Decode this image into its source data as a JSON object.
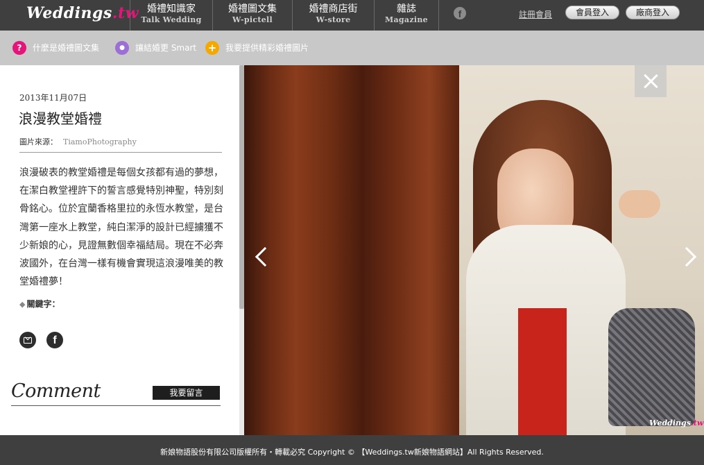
{
  "header": {
    "logo": {
      "brand": "Weddings",
      "tld": ".tw"
    },
    "nav": [
      {
        "zh": "婚禮知識家",
        "en": "Talk Wedding"
      },
      {
        "zh": "婚禮圖文集",
        "en": "W-pictell"
      },
      {
        "zh": "婚禮商店街",
        "en": "W-store"
      },
      {
        "zh": "雜誌",
        "en": "Magazine"
      }
    ],
    "facebook_glyph": "f",
    "register_label": "註冊會員",
    "member_login_label": "會員登入",
    "vendor_login_label": "廠商登入"
  },
  "subnav": [
    {
      "label": "什麼是婚禮圖文集",
      "icon": "question-icon",
      "glyph": "?",
      "color": "#e4147a"
    },
    {
      "label": "讓結婚更 Smart",
      "icon": "bulb-icon",
      "glyph": "●",
      "color": "#9b6fd6"
    },
    {
      "label": "我要提供精彩婚禮圖片",
      "icon": "plus-icon",
      "glyph": "+",
      "color": "#f5a800"
    }
  ],
  "article": {
    "date": "2013年11月07日",
    "title": "浪漫教堂婚禮",
    "source_label": "圖片來源：",
    "source_value": "TiamoPhotography",
    "description": "浪漫破表的教堂婚禮是每個女孩都有過的夢想，在潔白教堂裡許下的誓言感覺特別神聖，特別刻骨銘心。位於宜蘭香格里拉的永恆水教堂，是台灣第一座水上教堂，純白潔淨的設計已經擄獲不少新娘的心，見證無數個幸福結局。現在不必奔波國外，在台灣一樣有機會實現這浪漫唯美的教堂婚禮夢！",
    "keywords_label": "關鍵字：",
    "share_fb_glyph": "f"
  },
  "comment": {
    "title": "Comment",
    "button_label": "我要留言"
  },
  "photo": {
    "watermark_brand": "Weddings",
    "watermark_tld": ".tw"
  },
  "footer": {
    "text": "新娘物語股份有限公司版權所有・轉載必究 Copyright © 【Weddings.tw新娘物語網站】All Rights Reserved."
  },
  "colors": {
    "topbar": "#3f3f3f",
    "subbar": "#c8c8c8",
    "brand_accent": "#e4147a"
  }
}
